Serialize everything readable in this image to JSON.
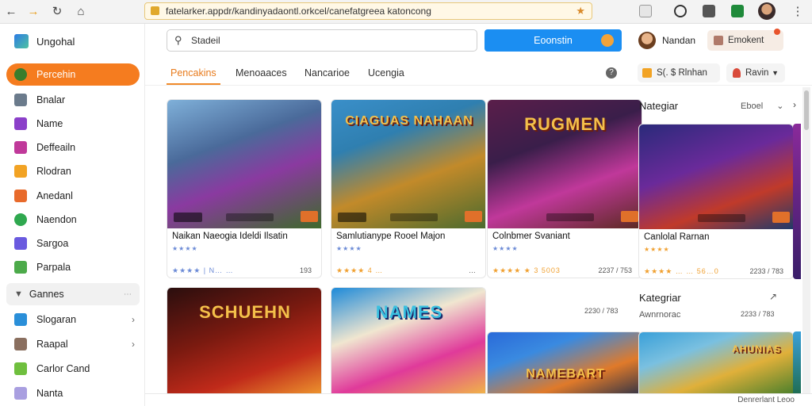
{
  "browser": {
    "address": "fatelarker.appdr/kandinyadaontl.orkcel/canefatgreea katoncong",
    "nav_icons": [
      "back-icon",
      "forward-icon",
      "reload-icon",
      "home-icon"
    ],
    "extension_icons": [
      "puzzle-icon",
      "clock-icon",
      "camera-icon",
      "sheet-icon",
      "profile-avatar-icon",
      "menu-icon"
    ]
  },
  "sidebar": {
    "brand": "Ungohal",
    "items": [
      {
        "label": "Percehin",
        "icon": "profile-icon",
        "color": "#3a7d2c",
        "active": true
      },
      {
        "label": "Bnalar",
        "icon": "grid-icon",
        "color": "#6b7b8c"
      },
      {
        "label": "Name",
        "icon": "apps-icon",
        "color": "#8b3fc9"
      },
      {
        "label": "Deffeailn",
        "icon": "bookmark-icon",
        "color": "#c0399a"
      },
      {
        "label": "Rlodran",
        "icon": "folder-icon",
        "color": "#f2a324"
      },
      {
        "label": "Anedanl",
        "icon": "game-icon",
        "color": "#e86a2b"
      },
      {
        "label": "Naendon",
        "icon": "circle-icon",
        "color": "#2fa84f"
      },
      {
        "label": "Sargoa",
        "icon": "star-icon",
        "color": "#6a5adf"
      },
      {
        "label": "Parpala",
        "icon": "tag-icon",
        "color": "#4caa4a"
      }
    ],
    "section_label": "Gannes",
    "section_items": [
      {
        "label": "Slogaran",
        "icon": "chat-icon",
        "color": "#2a8fd9",
        "has_chevron": true
      },
      {
        "label": "Raapal",
        "icon": "box-icon",
        "color": "#8a6f5f",
        "has_chevron": true
      },
      {
        "label": "Carlor Cand",
        "icon": "card-icon",
        "color": "#6fbf3e",
        "has_chevron": false
      },
      {
        "label": "Nanta",
        "icon": "note-icon",
        "color": "#a99fe0",
        "has_chevron": false
      }
    ]
  },
  "header": {
    "search_value": "Stadeil",
    "cta_label": "Eoonstin",
    "user_name": "Nandan",
    "account_button": "Emokent"
  },
  "tabs": [
    {
      "label": "Pencakins",
      "active": true
    },
    {
      "label": "Menoaaces",
      "active": false
    },
    {
      "label": "Nancarioe",
      "active": false
    },
    {
      "label": "Ucengia",
      "active": false
    }
  ],
  "filters": {
    "pill_one": "S(. $ Rlnhan",
    "pill_two": "Ravin"
  },
  "cards": [
    {
      "name": "Naikan Naeogia Ideldi Ilsatin",
      "meta_left": "★★★★ | N… …",
      "meta_right": "193",
      "art_title": "",
      "colors": [
        "#3a4a8a",
        "#8a3aa0",
        "#3d6a2a"
      ]
    },
    {
      "name": "Samlutianype Rooel Majon",
      "meta_left": "★★★★ 4 …",
      "meta_right": "…",
      "art_title": "CIAGUAS NAHAAN",
      "colors": [
        "#2f7fb0",
        "#c28a2a",
        "#4a6a2e"
      ]
    },
    {
      "name": "Colnbmer Svaniant",
      "meta_left": "★★★★ ★ 3 5003",
      "meta_right": "2237 / 753",
      "art_title": "RUGMEN",
      "colors": [
        "#3a1e4a",
        "#c0389a",
        "#5a2a20"
      ]
    },
    {
      "name": "Canlolal Rarnan",
      "meta_left": "★★★★ … … 56…0",
      "meta_right": "2233 / 783",
      "art_title": "",
      "colors": [
        "#2a2a7a",
        "#c03a2a",
        "#1e3a6a"
      ]
    }
  ],
  "cards_row2": [
    {
      "art_title": "SCHUEHN",
      "colors": [
        "#2a0e0e",
        "#c02a1a",
        "#f2a030"
      ]
    },
    {
      "art_title": "NAMES",
      "colors": [
        "#1e8ad9",
        "#e03a9a",
        "#f2c040"
      ]
    },
    {
      "art_title": "NAMEBART",
      "colors": [
        "#2a6ad9",
        "#e07a2a",
        "#1a2a4a"
      ]
    },
    {
      "art_title": "AHUNIAS",
      "colors": [
        "#3aa0d9",
        "#e0b03a",
        "#3a7a2a"
      ]
    }
  ],
  "right_panel": {
    "title": "Nategiar",
    "side": "Eboel",
    "card_name": "Canlolal Rarnan",
    "subtitle_one": "2233 / 783",
    "section_title": "Kategriar",
    "section_sub": "Awnrnorac",
    "section_meta": "2233 / 783",
    "mid_meta": "2230 / 783"
  },
  "status_text": "Denrerlant Leoo"
}
